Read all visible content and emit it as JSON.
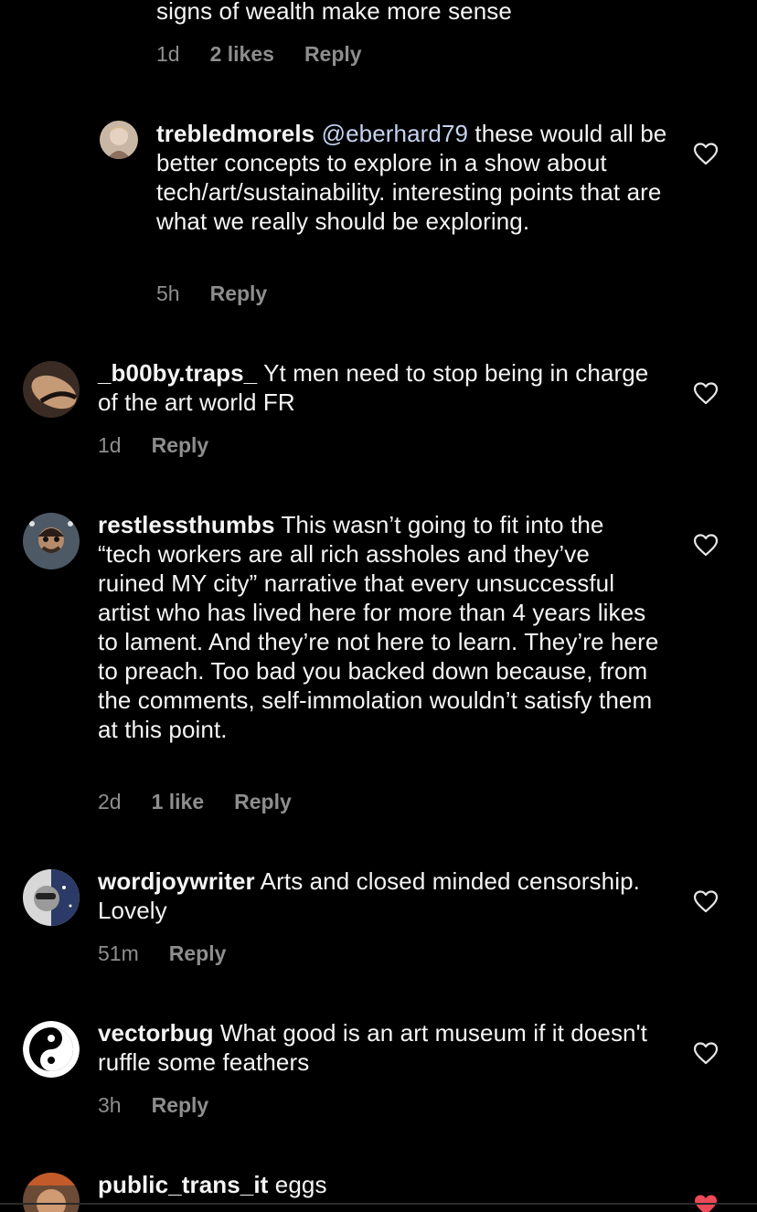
{
  "top_reply": {
    "text_tail": "signs of wealth make more sense",
    "time": "1d",
    "likes": "2 likes",
    "reply": "Reply"
  },
  "comments": [
    {
      "username": "trebledmorels",
      "mention": "@eberhard79",
      "text": " these would all be better concepts to explore in a show about tech/art/sustainability. interesting points that are what we really should be exploring.",
      "time": "5h",
      "likes": "",
      "reply": "Reply"
    },
    {
      "username": "_b00by.traps_",
      "text": " Yt men need to stop being in charge of the art world FR",
      "time": "1d",
      "likes": "",
      "reply": "Reply"
    },
    {
      "username": "restlessthumbs",
      "text": " This wasn’t going to fit into the “tech workers are all rich assholes and they’ve ruined MY city” narrative that every unsuccessful artist who has lived here for more than 4 years likes to lament. And they’re not here to learn. They’re here to preach. Too bad you backed down because, from the comments, self-immolation wouldn’t satisfy them at this point.",
      "time": "2d",
      "likes": "1 like",
      "reply": "Reply"
    },
    {
      "username": "wordjoywriter",
      "text": " Arts and closed minded censorship.  Lovely",
      "time": "51m",
      "likes": "",
      "reply": "Reply"
    },
    {
      "username": "vectorbug",
      "text": " What good is an art museum if it doesn't ruffle some feathers",
      "time": "3h",
      "likes": "",
      "reply": "Reply"
    },
    {
      "username": "public_trans_it",
      "text": " eggs"
    }
  ],
  "colors": {
    "background": "#000000",
    "text": "#f5f5f5",
    "meta": "#8e8e8e",
    "mention": "#c6d2f0",
    "liked_heart": "#ed4956"
  },
  "icons": {
    "like": "heart-outline-icon",
    "liked": "heart-filled-icon"
  }
}
